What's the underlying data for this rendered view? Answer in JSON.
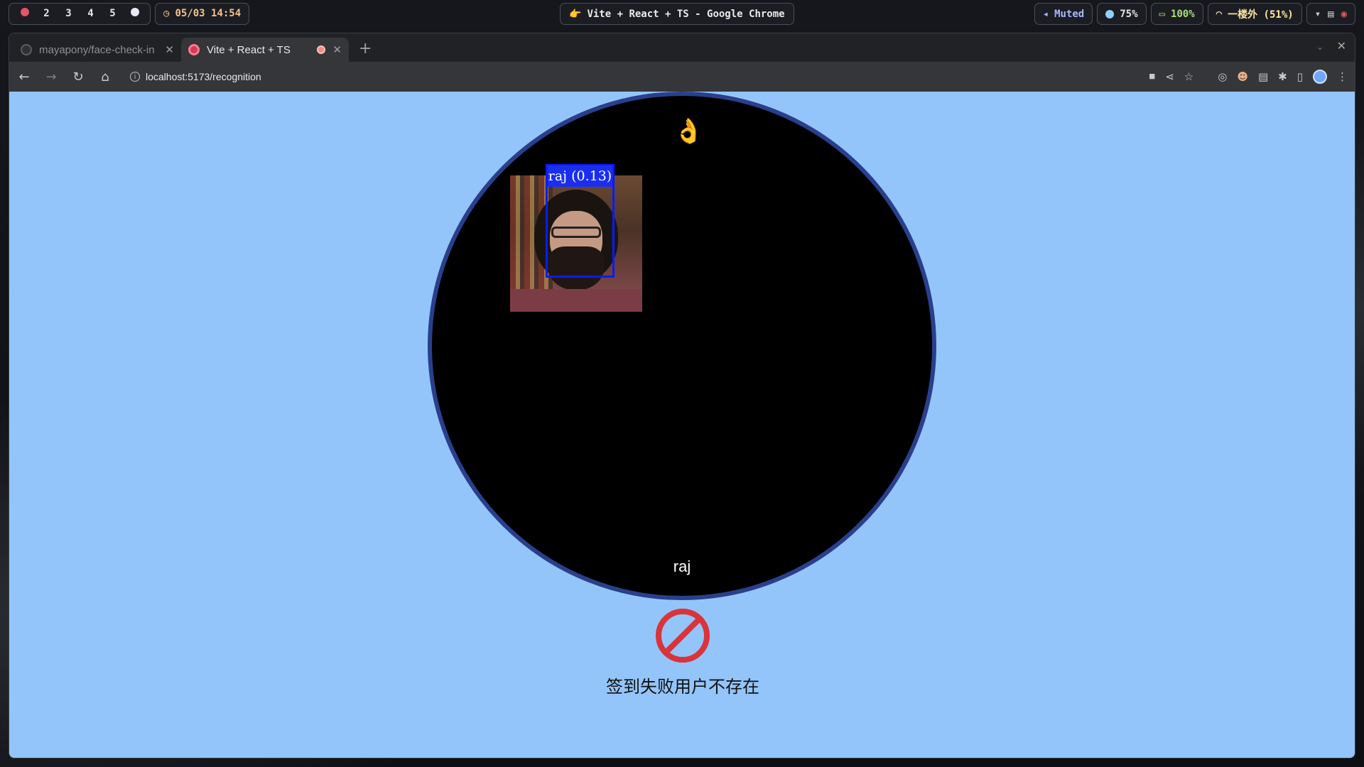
{
  "topbar": {
    "workspaces": [
      "2",
      "3",
      "4",
      "5"
    ],
    "datetime": "05/03 14:54",
    "window_title": "Vite + React + TS - Google Chrome",
    "audio": "Muted",
    "cpu": "75%",
    "battery": "100%",
    "wifi": "一楼外 (51%)"
  },
  "browser": {
    "tabs": [
      {
        "label": "mayapony/face-check-in",
        "active": false
      },
      {
        "label": "Vite + React + TS",
        "active": true
      }
    ],
    "url": "localhost:5173/recognition"
  },
  "page": {
    "emoji": "👌",
    "detection_label": "raj (0.13)",
    "recognized_name": "raj",
    "status_message": "签到失败用户不存在",
    "colors": {
      "background": "#93c5fa",
      "circle_border": "#2a3f8c",
      "detect_box": "#0a1bff",
      "fail_icon": "#d9343a"
    }
  }
}
